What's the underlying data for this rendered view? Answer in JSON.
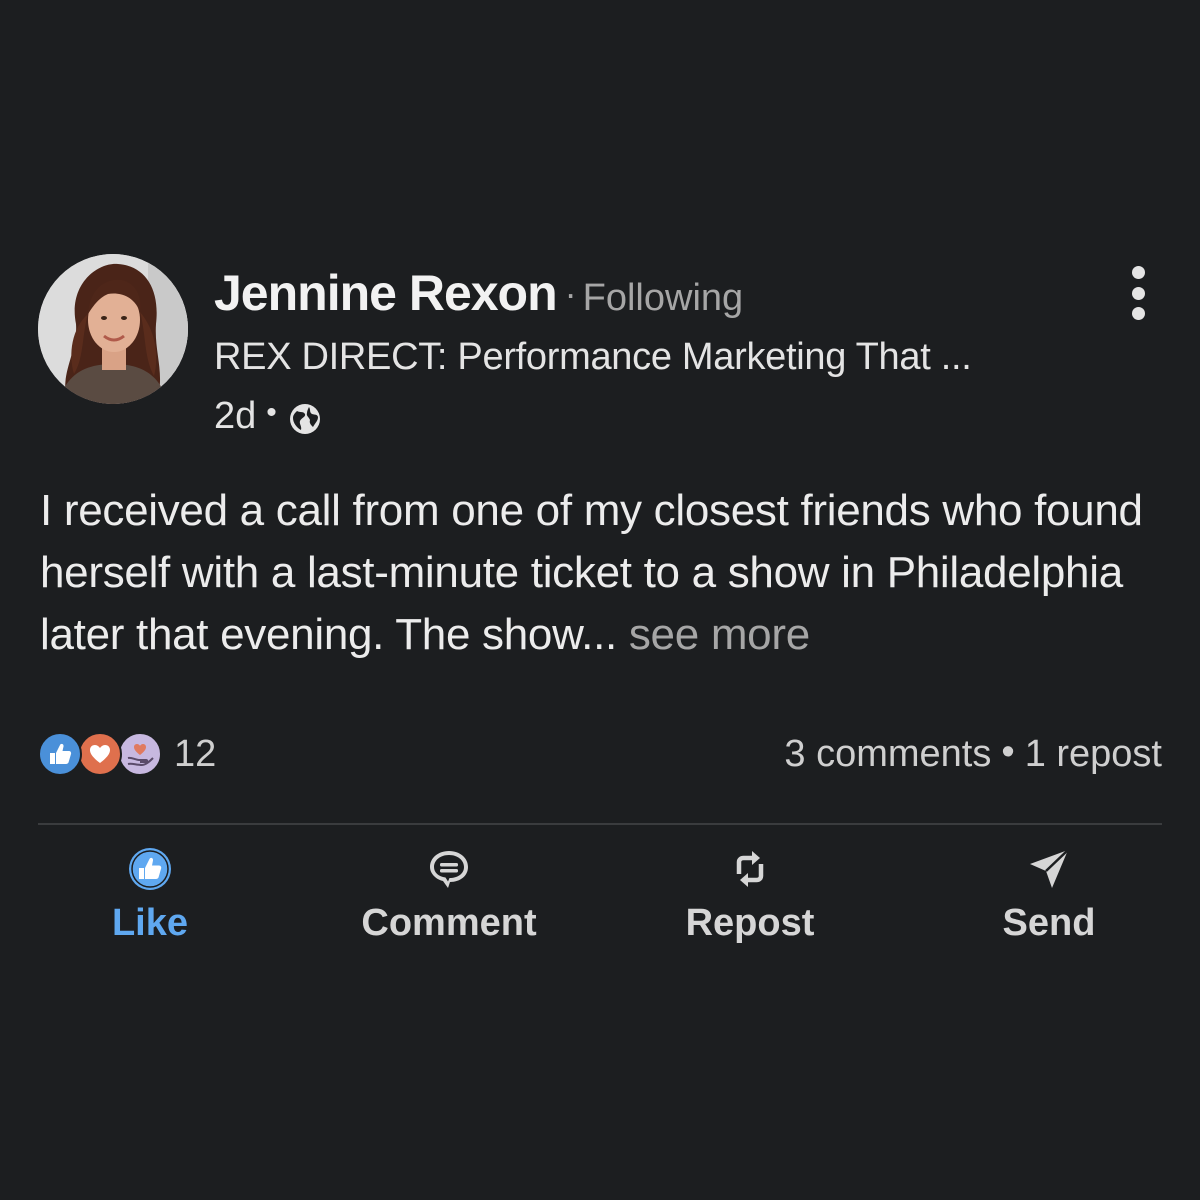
{
  "post": {
    "author": {
      "name": "Jennine Rexon",
      "separator": "·",
      "follow_status": "Following",
      "headline": "REX DIRECT: Performance Marketing That ...",
      "time_ago": "2d",
      "meta_separator": "•",
      "visibility_icon": "globe-icon"
    },
    "body_text": "I received a call from one of my closest friends who found herself with a last-minute ticket to a show in Philadelphia later that evening. The show...",
    "see_more": " see more",
    "reactions": {
      "icons": [
        "like-reaction-icon",
        "love-reaction-icon",
        "support-reaction-icon"
      ],
      "count": "12"
    },
    "stats": {
      "comments": "3 comments",
      "separator": "•",
      "reposts": "1 repost"
    },
    "actions": {
      "like": "Like",
      "comment": "Comment",
      "repost": "Repost",
      "send": "Send"
    },
    "colors": {
      "background": "#1c1e20",
      "like_blue": "#5fa8f0",
      "muted_text": "#a6a6a6",
      "love_orange": "#df704d",
      "support_lavender": "#c7b8e0"
    }
  }
}
